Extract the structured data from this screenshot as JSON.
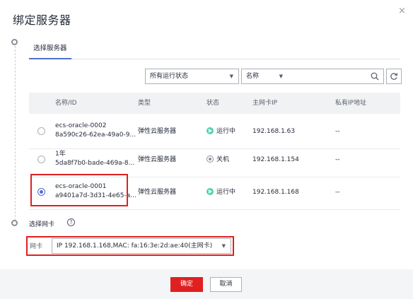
{
  "dialog": {
    "title": "绑定服务器",
    "close_glyph": "×"
  },
  "tabs": [
    {
      "label": "选择服务器",
      "active": true
    }
  ],
  "filters": {
    "status_select": "所有运行状态",
    "field_select": "名称",
    "search_value": ""
  },
  "table": {
    "headers": [
      "名称/ID",
      "类型",
      "状态",
      "主网卡IP",
      "私有IP地址"
    ],
    "rows": [
      {
        "name": "ecs-oracle-0002",
        "id": "8a590c26-62ea-49a0-9...",
        "type": "弹性云服务器",
        "status": "运行中",
        "status_kind": "running",
        "ip": "192.168.1.63",
        "private_ip": "--",
        "selected": false
      },
      {
        "name": "1年",
        "id": "5da8f7b0-bade-469a-8...",
        "type": "弹性云服务器",
        "status": "关机",
        "status_kind": "stopped",
        "ip": "192.168.1.154",
        "private_ip": "--",
        "selected": false
      },
      {
        "name": "ecs-oracle-0001",
        "id": "a9401a7d-3d31-4e65-a...",
        "type": "弹性云服务器",
        "status": "运行中",
        "status_kind": "running",
        "ip": "192.168.1.168",
        "private_ip": "--",
        "selected": true
      }
    ]
  },
  "nic": {
    "section_title": "选择网卡",
    "help_glyph": "?",
    "label": "网卡",
    "selected": "IP 192.168.1.168,MAC: fa:16:3e:2d:ae:40(主网卡)"
  },
  "footer": {
    "ok_label": "确定",
    "cancel_label": "取消"
  },
  "colors": {
    "accent": "#526ecc",
    "danger": "#e02020",
    "running": "#50d4ab"
  }
}
